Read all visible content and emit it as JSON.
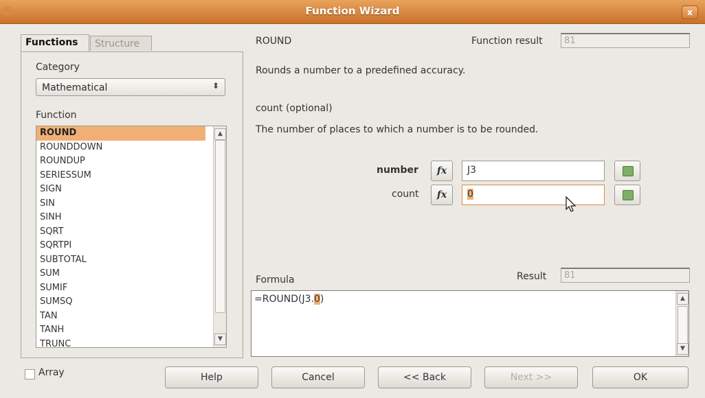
{
  "window": {
    "title": "Function Wizard",
    "close_label": "x"
  },
  "tabs": [
    {
      "label": "Functions",
      "active": true
    },
    {
      "label": "Structure",
      "active": false
    }
  ],
  "category": {
    "label": "Category",
    "selected": "Mathematical"
  },
  "function_list": {
    "label": "Function",
    "items": [
      "ROUND",
      "ROUNDDOWN",
      "ROUNDUP",
      "SERIESSUM",
      "SIGN",
      "SIN",
      "SINH",
      "SQRT",
      "SQRTPI",
      "SUBTOTAL",
      "SUM",
      "SUMIF",
      "SUMSQ",
      "TAN",
      "TANH",
      "TRUNC"
    ],
    "selected": "ROUND"
  },
  "details": {
    "function_name": "ROUND",
    "function_result_label": "Function result",
    "function_result_value": "81",
    "description": "Rounds a number to a predefined accuracy.",
    "arg_title": "count (optional)",
    "arg_description": "The number of places to which a number is to be rounded."
  },
  "arguments": [
    {
      "label": "number",
      "value": "J3",
      "bold": true
    },
    {
      "label": "count",
      "value": "0",
      "bold": false
    }
  ],
  "formula": {
    "label": "Formula",
    "result_label": "Result",
    "result_value": "81",
    "value_prefix": "=ROUND(J3.",
    "value_highlight": "0",
    "value_suffix": ")"
  },
  "array_label": "Array",
  "buttons": {
    "help": "Help",
    "cancel": "Cancel",
    "back": "<< Back",
    "next": "Next >>",
    "ok": "OK"
  },
  "icons": {
    "fx": "fx-icon",
    "shrink": "shrink-icon",
    "cursor": "mouse-cursor-icon"
  },
  "colors": {
    "titlebar": "#d98a45",
    "selection": "#f0b075"
  }
}
